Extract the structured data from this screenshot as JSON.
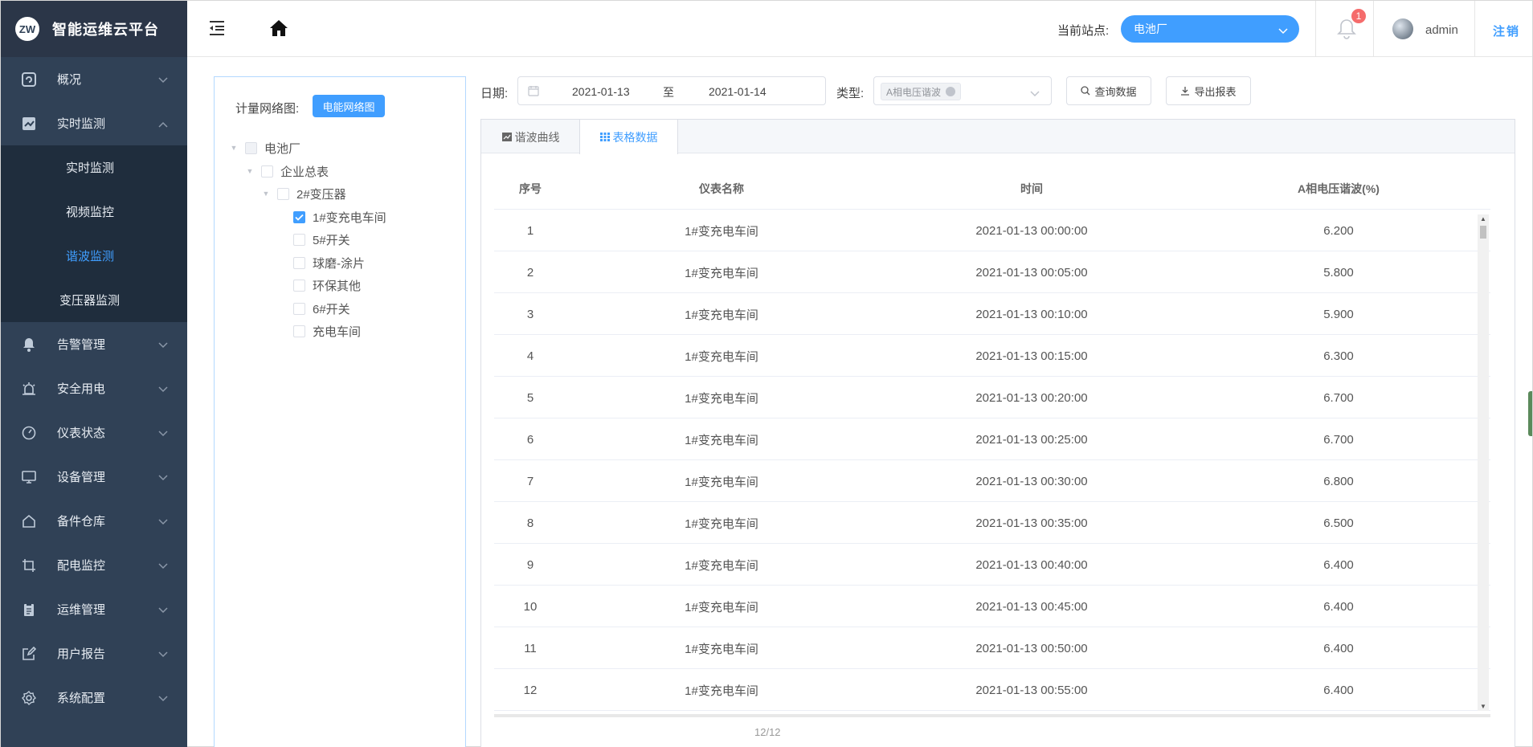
{
  "app": {
    "logo_mark": "ZW",
    "title": "智能运维云平台"
  },
  "sidebar": {
    "items": [
      {
        "label": "概况",
        "icon": "overview-icon",
        "expanded": false
      },
      {
        "label": "实时监测",
        "icon": "chart-icon",
        "expanded": true,
        "children": [
          {
            "label": "实时监测",
            "active": false
          },
          {
            "label": "视频监控",
            "active": false
          },
          {
            "label": "谐波监测",
            "active": true
          },
          {
            "label": "变压器监测",
            "active": false
          }
        ]
      },
      {
        "label": "告警管理",
        "icon": "bell-icon",
        "expanded": false
      },
      {
        "label": "安全用电",
        "icon": "alarm-light-icon",
        "expanded": false
      },
      {
        "label": "仪表状态",
        "icon": "gauge-icon",
        "expanded": false
      },
      {
        "label": "设备管理",
        "icon": "monitor-icon",
        "expanded": false
      },
      {
        "label": "备件仓库",
        "icon": "house-icon",
        "expanded": false
      },
      {
        "label": "配电监控",
        "icon": "crop-icon",
        "expanded": false
      },
      {
        "label": "运维管理",
        "icon": "clipboard-icon",
        "expanded": false
      },
      {
        "label": "用户报告",
        "icon": "edit-icon",
        "expanded": false
      },
      {
        "label": "系统配置",
        "icon": "settings-icon",
        "expanded": false
      }
    ]
  },
  "header": {
    "site_label": "当前站点:",
    "site_value": "电池厂",
    "notification_count": "1",
    "username": "admin",
    "logout": "注销"
  },
  "tree": {
    "label": "计量网络图:",
    "button": "电能网络图",
    "nodes": [
      {
        "label": "电池厂",
        "level": 0,
        "expandable": true,
        "state": "indeterminate"
      },
      {
        "label": "企业总表",
        "level": 1,
        "expandable": true,
        "state": "unchecked"
      },
      {
        "label": "2#变压器",
        "level": 2,
        "expandable": true,
        "state": "unchecked"
      },
      {
        "label": "1#变充电车间",
        "level": 3,
        "expandable": false,
        "state": "checked"
      },
      {
        "label": "5#开关",
        "level": 3,
        "expandable": false,
        "state": "unchecked"
      },
      {
        "label": "球磨-涂片",
        "level": 3,
        "expandable": false,
        "state": "unchecked"
      },
      {
        "label": "环保其他",
        "level": 3,
        "expandable": false,
        "state": "unchecked"
      },
      {
        "label": "6#开关",
        "level": 3,
        "expandable": false,
        "state": "unchecked"
      },
      {
        "label": "充电车间",
        "level": 3,
        "expandable": false,
        "state": "unchecked"
      }
    ]
  },
  "filters": {
    "date_label": "日期:",
    "date_start": "2021-01-13",
    "date_separator": "至",
    "date_end": "2021-01-14",
    "type_label": "类型:",
    "type_tag": "A相电压谐波",
    "query_button": "查询数据",
    "export_button": "导出报表"
  },
  "tabs": [
    {
      "label": "谐波曲线",
      "active": false
    },
    {
      "label": "表格数据",
      "active": true
    }
  ],
  "table": {
    "columns": [
      "序号",
      "仪表名称",
      "时间",
      "A相电压谐波(%)"
    ],
    "rows": [
      [
        "1",
        "1#变充电车间",
        "2021-01-13 00:00:00",
        "6.200"
      ],
      [
        "2",
        "1#变充电车间",
        "2021-01-13 00:05:00",
        "5.800"
      ],
      [
        "3",
        "1#变充电车间",
        "2021-01-13 00:10:00",
        "5.900"
      ],
      [
        "4",
        "1#变充电车间",
        "2021-01-13 00:15:00",
        "6.300"
      ],
      [
        "5",
        "1#变充电车间",
        "2021-01-13 00:20:00",
        "6.700"
      ],
      [
        "6",
        "1#变充电车间",
        "2021-01-13 00:25:00",
        "6.700"
      ],
      [
        "7",
        "1#变充电车间",
        "2021-01-13 00:30:00",
        "6.800"
      ],
      [
        "8",
        "1#变充电车间",
        "2021-01-13 00:35:00",
        "6.500"
      ],
      [
        "9",
        "1#变充电车间",
        "2021-01-13 00:40:00",
        "6.400"
      ],
      [
        "10",
        "1#变充电车间",
        "2021-01-13 00:45:00",
        "6.400"
      ],
      [
        "11",
        "1#变充电车间",
        "2021-01-13 00:50:00",
        "6.400"
      ],
      [
        "12",
        "1#变充电车间",
        "2021-01-13 00:55:00",
        "6.400"
      ]
    ],
    "page_count": "12/12"
  },
  "colors": {
    "sidebar_bg": "#304156",
    "submenu_bg": "#1f2d3d",
    "accent": "#409eff",
    "badge": "#f56c6c"
  }
}
